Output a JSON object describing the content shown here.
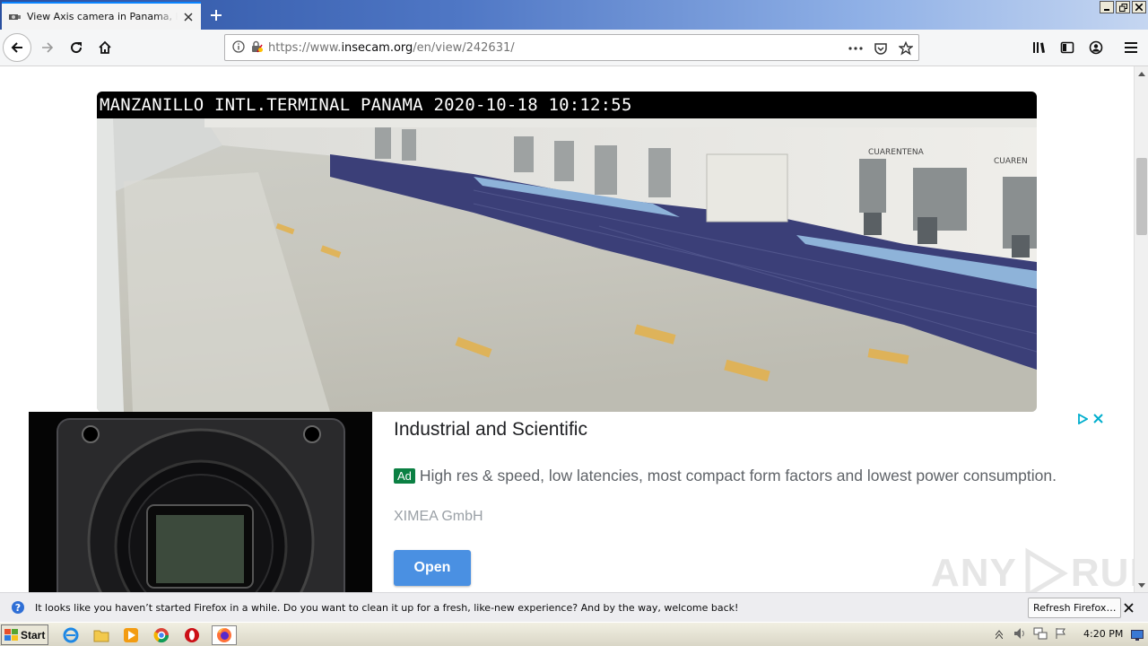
{
  "browser": {
    "tab_title": "View Axis camera in Panama, Panama",
    "url_prefix": "https://www.",
    "url_domain": "insecam.org",
    "url_path": "/en/view/242631/"
  },
  "camera": {
    "overlay_text": "MANZANILLO INTL.TERMINAL PANAMA 2020-10-18 10:12:55",
    "sign_1": "CUARENTENA",
    "sign_2": "CUAREN"
  },
  "ad": {
    "headline": "Industrial and Scientific",
    "badge": "Ad",
    "description": "High res & speed, low latencies, most compact form factors and lowest power consumption.",
    "advertiser": "XIMEA GmbH",
    "cta": "Open"
  },
  "watermark": {
    "left": "ANY",
    "right": "RUN"
  },
  "notification": {
    "text": "It looks like you haven’t started Firefox in a while. Do you want to clean it up for a fresh, like-new experience? And by the way, welcome back!",
    "button": "Refresh Firefox…"
  },
  "taskbar": {
    "start_label": "Start",
    "clock": "4:20 PM"
  },
  "colors": {
    "accent": "#0a84ff",
    "ad_badge": "#0b8043",
    "ad_button": "#4a90e2"
  }
}
